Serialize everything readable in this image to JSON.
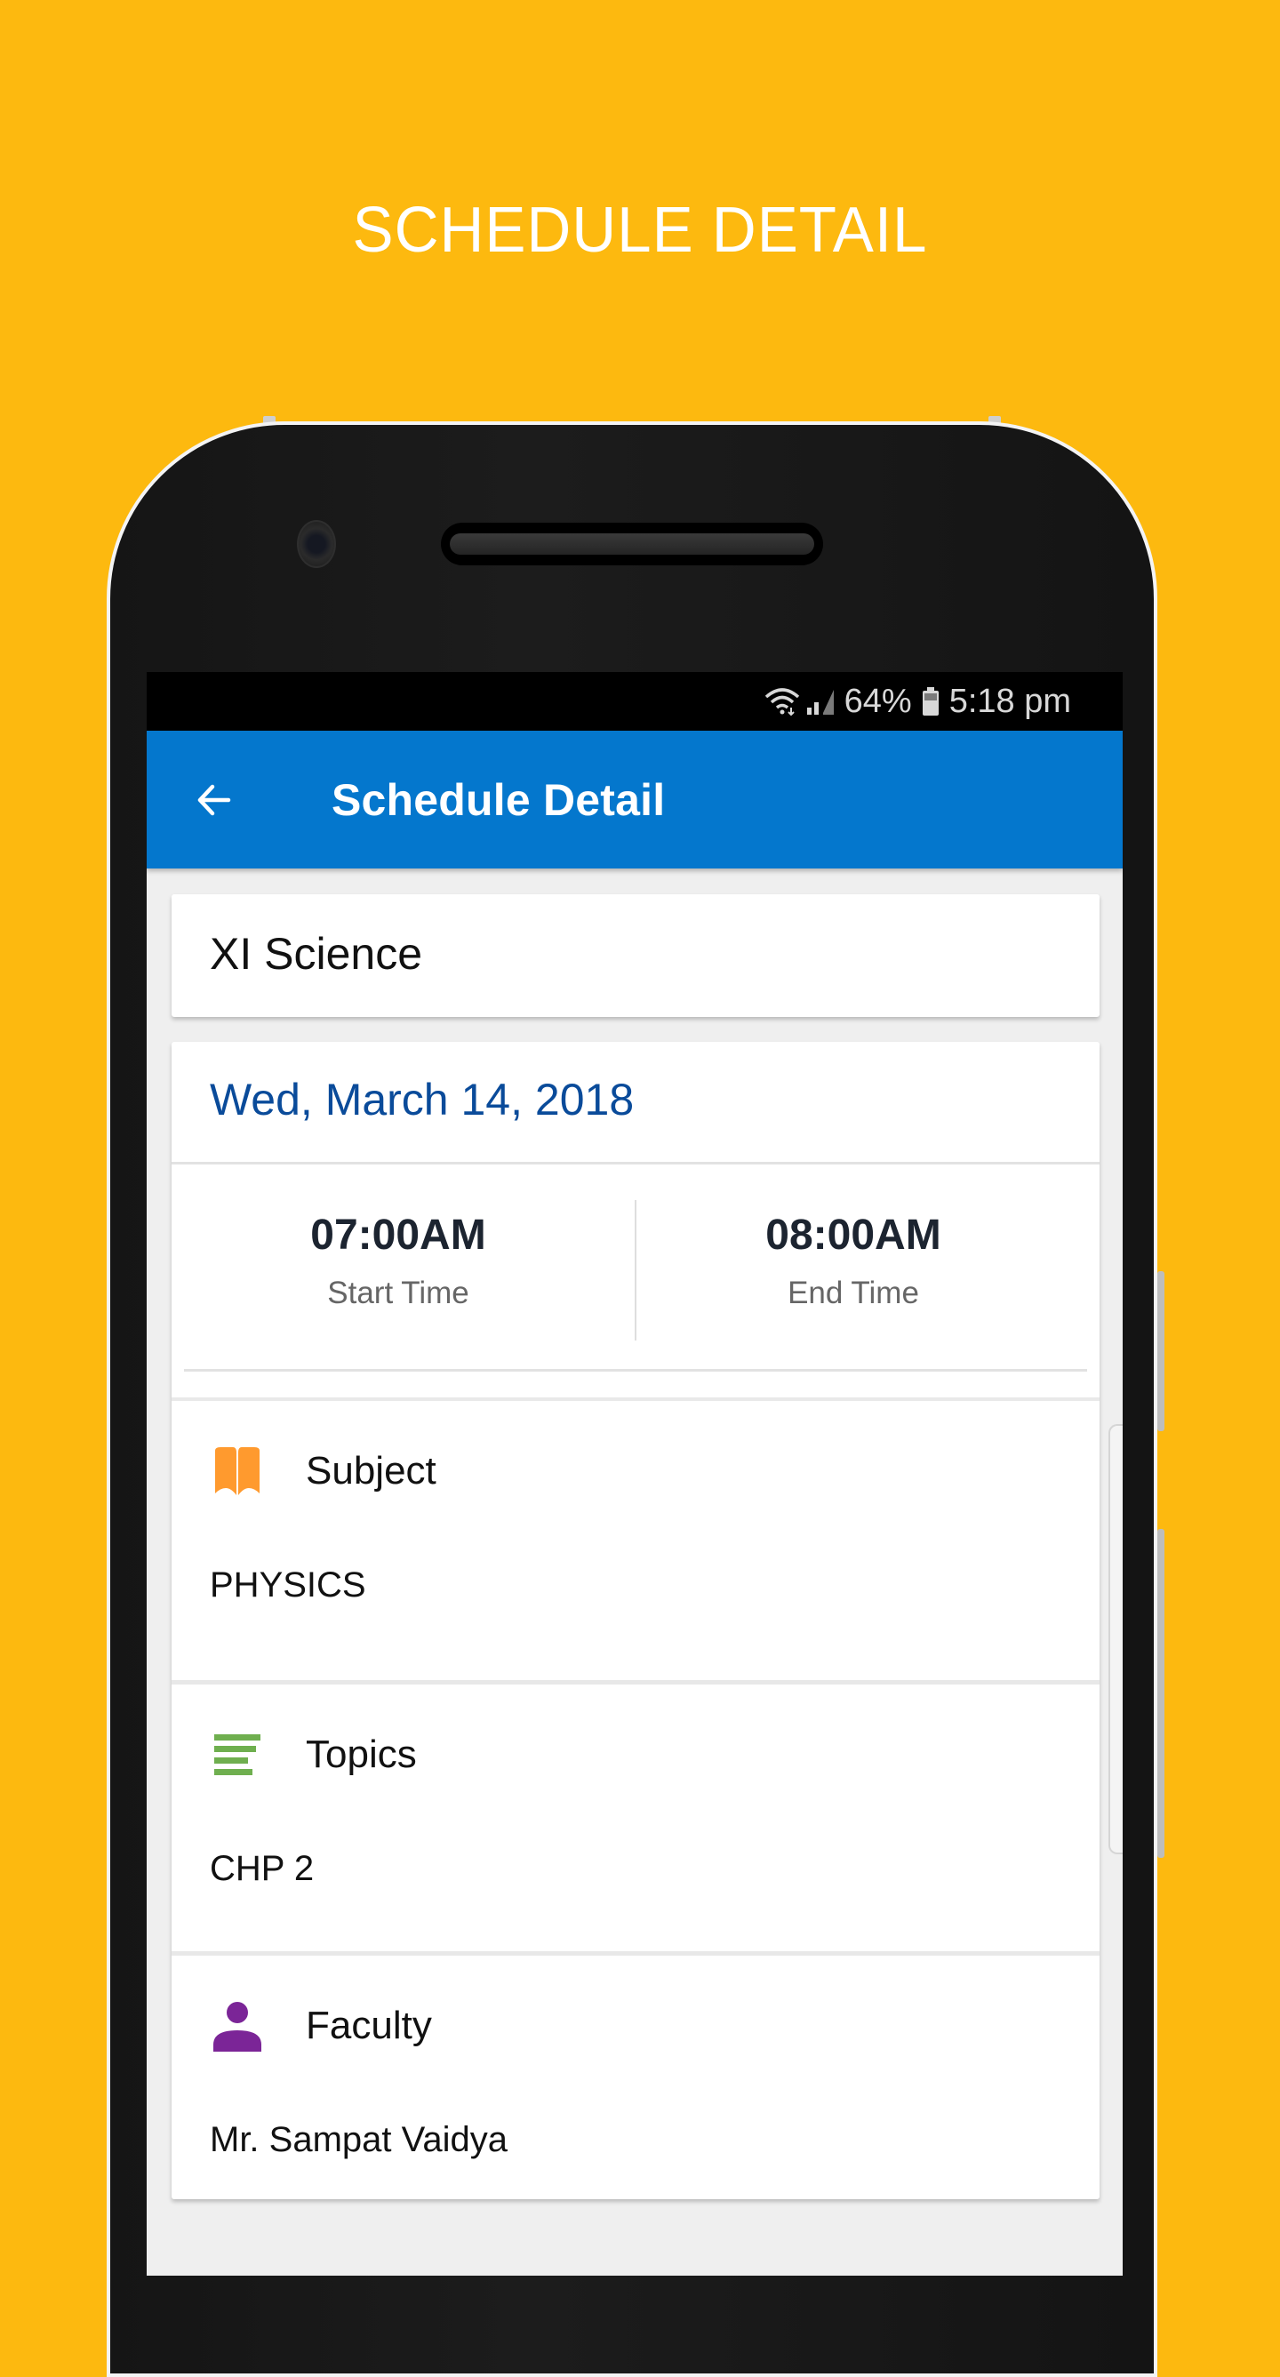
{
  "promo": {
    "title": "SCHEDULE DETAIL"
  },
  "statusbar": {
    "wifi_icon": "wifi-icon",
    "signal_icon": "signal-icon",
    "battery_percent": "64%",
    "battery_icon": "battery-icon",
    "time": "5:18 pm"
  },
  "appbar": {
    "back_icon": "arrow-left-icon",
    "title": "Schedule Detail",
    "color": "#0477CD"
  },
  "class_card": {
    "name": "XI Science"
  },
  "schedule": {
    "date": "Wed, March 14, 2018",
    "start_time": "07:00AM",
    "start_label": "Start Time",
    "end_time": "08:00AM",
    "end_label": "End Time",
    "sections": [
      {
        "icon": "book-icon",
        "icon_color": "#FF9A2E",
        "label": "Subject",
        "value": "PHYSICS"
      },
      {
        "icon": "list-icon",
        "icon_color": "#6FAF4F",
        "label": "Topics",
        "value": "CHP 2"
      },
      {
        "icon": "person-icon",
        "icon_color": "#7B2597",
        "label": "Faculty",
        "value": "Mr. Sampat Vaidya"
      }
    ]
  },
  "colors": {
    "background": "#FDB90F",
    "date_text": "#0A4B9A"
  }
}
